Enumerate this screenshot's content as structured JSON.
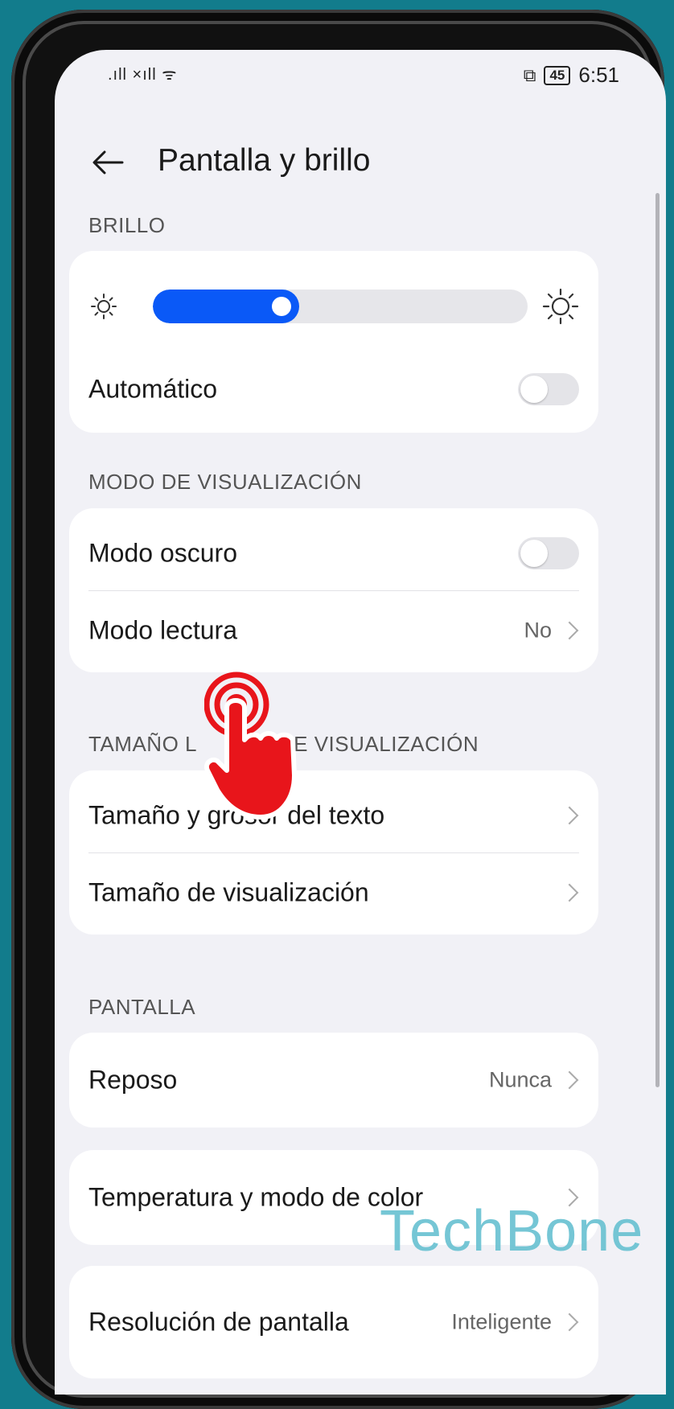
{
  "statusbar": {
    "signal": ".ıll ×ıll ᯤ",
    "cast_icon": "cast-icon",
    "battery": "45",
    "time": "6:51"
  },
  "header": {
    "back_icon": "back-arrow-icon",
    "title": "Pantalla y brillo"
  },
  "sections": {
    "brillo": {
      "label": "BRILLO",
      "brightness_level": 0.39,
      "auto_label": "Automático",
      "auto_enabled": false
    },
    "modo": {
      "label": "MODO DE VISUALIZACIÓN",
      "dark_label": "Modo oscuro",
      "dark_enabled": false,
      "reading_label": "Modo lectura",
      "reading_value": "No"
    },
    "tamano": {
      "label": "TAMAÑO L          Y DE VISUALIZACIÓN",
      "text_size_label": "Tamaño y grosor del texto",
      "display_size_label": "Tamaño de visualización"
    },
    "pantalla": {
      "label": "PANTALLA",
      "sleep_label": "Reposo",
      "sleep_value": "Nunca",
      "color_label": "Temperatura y modo de color",
      "resolution_label": "Resolución de pantalla",
      "resolution_value": "Inteligente"
    }
  },
  "watermark": "TechBone",
  "colors": {
    "accent": "#0a59f7",
    "tap_hand": "#e8151b",
    "background": "#127c8c"
  }
}
